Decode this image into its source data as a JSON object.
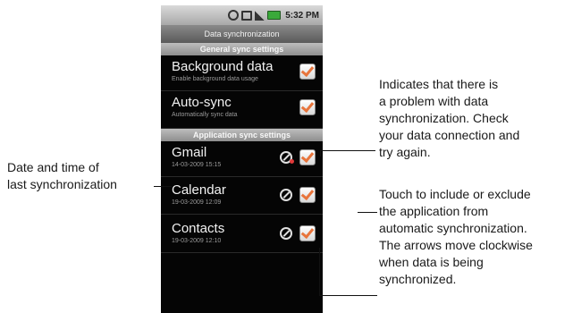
{
  "statusbar": {
    "time": "5:32 PM",
    "icons": [
      "sync-icon",
      "usb-icon",
      "signal-icon",
      "battery-icon"
    ]
  },
  "screen": {
    "title": "Data synchronization",
    "general_header": "General sync settings",
    "application_header": "Application sync settings"
  },
  "general_settings": [
    {
      "title": "Background data",
      "subtitle": "Enable background data usage",
      "checked": true
    },
    {
      "title": "Auto-sync",
      "subtitle": "Automatically sync data",
      "checked": true
    }
  ],
  "app_settings": [
    {
      "title": "Gmail",
      "subtitle": "14-03-2009 15:15",
      "checked": true,
      "sync_error": true
    },
    {
      "title": "Calendar",
      "subtitle": "19-03-2009 12:09",
      "checked": true,
      "sync_error": false
    },
    {
      "title": "Contacts",
      "subtitle": "19-03-2009 12:10",
      "checked": true,
      "sync_error": false
    }
  ],
  "annotations": {
    "date_time": [
      "Date and time of",
      "last synchronization"
    ],
    "problem": [
      "Indicates that there is",
      "a problem with data",
      "synchronization. Check",
      "your data connection and",
      "try again."
    ],
    "touch": [
      "Touch to include or exclude",
      "the application from",
      "automatic synchronization.",
      "The arrows move clockwise",
      "when data is being",
      "synchronized."
    ]
  },
  "colors": {
    "checkmark": "#e8743b",
    "screen_bg": "#050505",
    "section_header": "#a0a0a0"
  }
}
